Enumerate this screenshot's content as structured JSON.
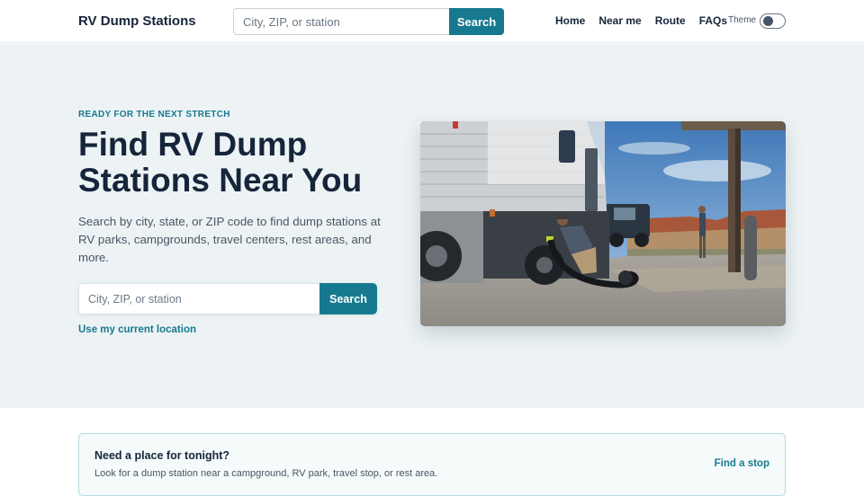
{
  "header": {
    "brand": "RV Dump Stations",
    "search": {
      "placeholder": "City, ZIP, or station",
      "button_label": "Search"
    },
    "nav": [
      "Home",
      "Near me",
      "Route",
      "FAQs"
    ],
    "theme_label": "Theme"
  },
  "hero": {
    "eyebrow": "READY FOR THE NEXT STRETCH",
    "title": "Find RV Dump Stations Near You",
    "description": "Search by city, state, or ZIP code to find dump stations at RV parks, campgrounds, travel centers, rest areas, and more.",
    "search": {
      "placeholder": "City, ZIP, or station",
      "button_label": "Search"
    },
    "location_link": "Use my current location"
  },
  "promo": {
    "title": "Need a place for tonight?",
    "text": "Look for a dump station near a campground, RV park, travel stop, or rest area.",
    "link": "Find a stop"
  },
  "colors": {
    "accent": "#17798f",
    "text": "#16253a",
    "hero_bg": "#edf3f5"
  }
}
